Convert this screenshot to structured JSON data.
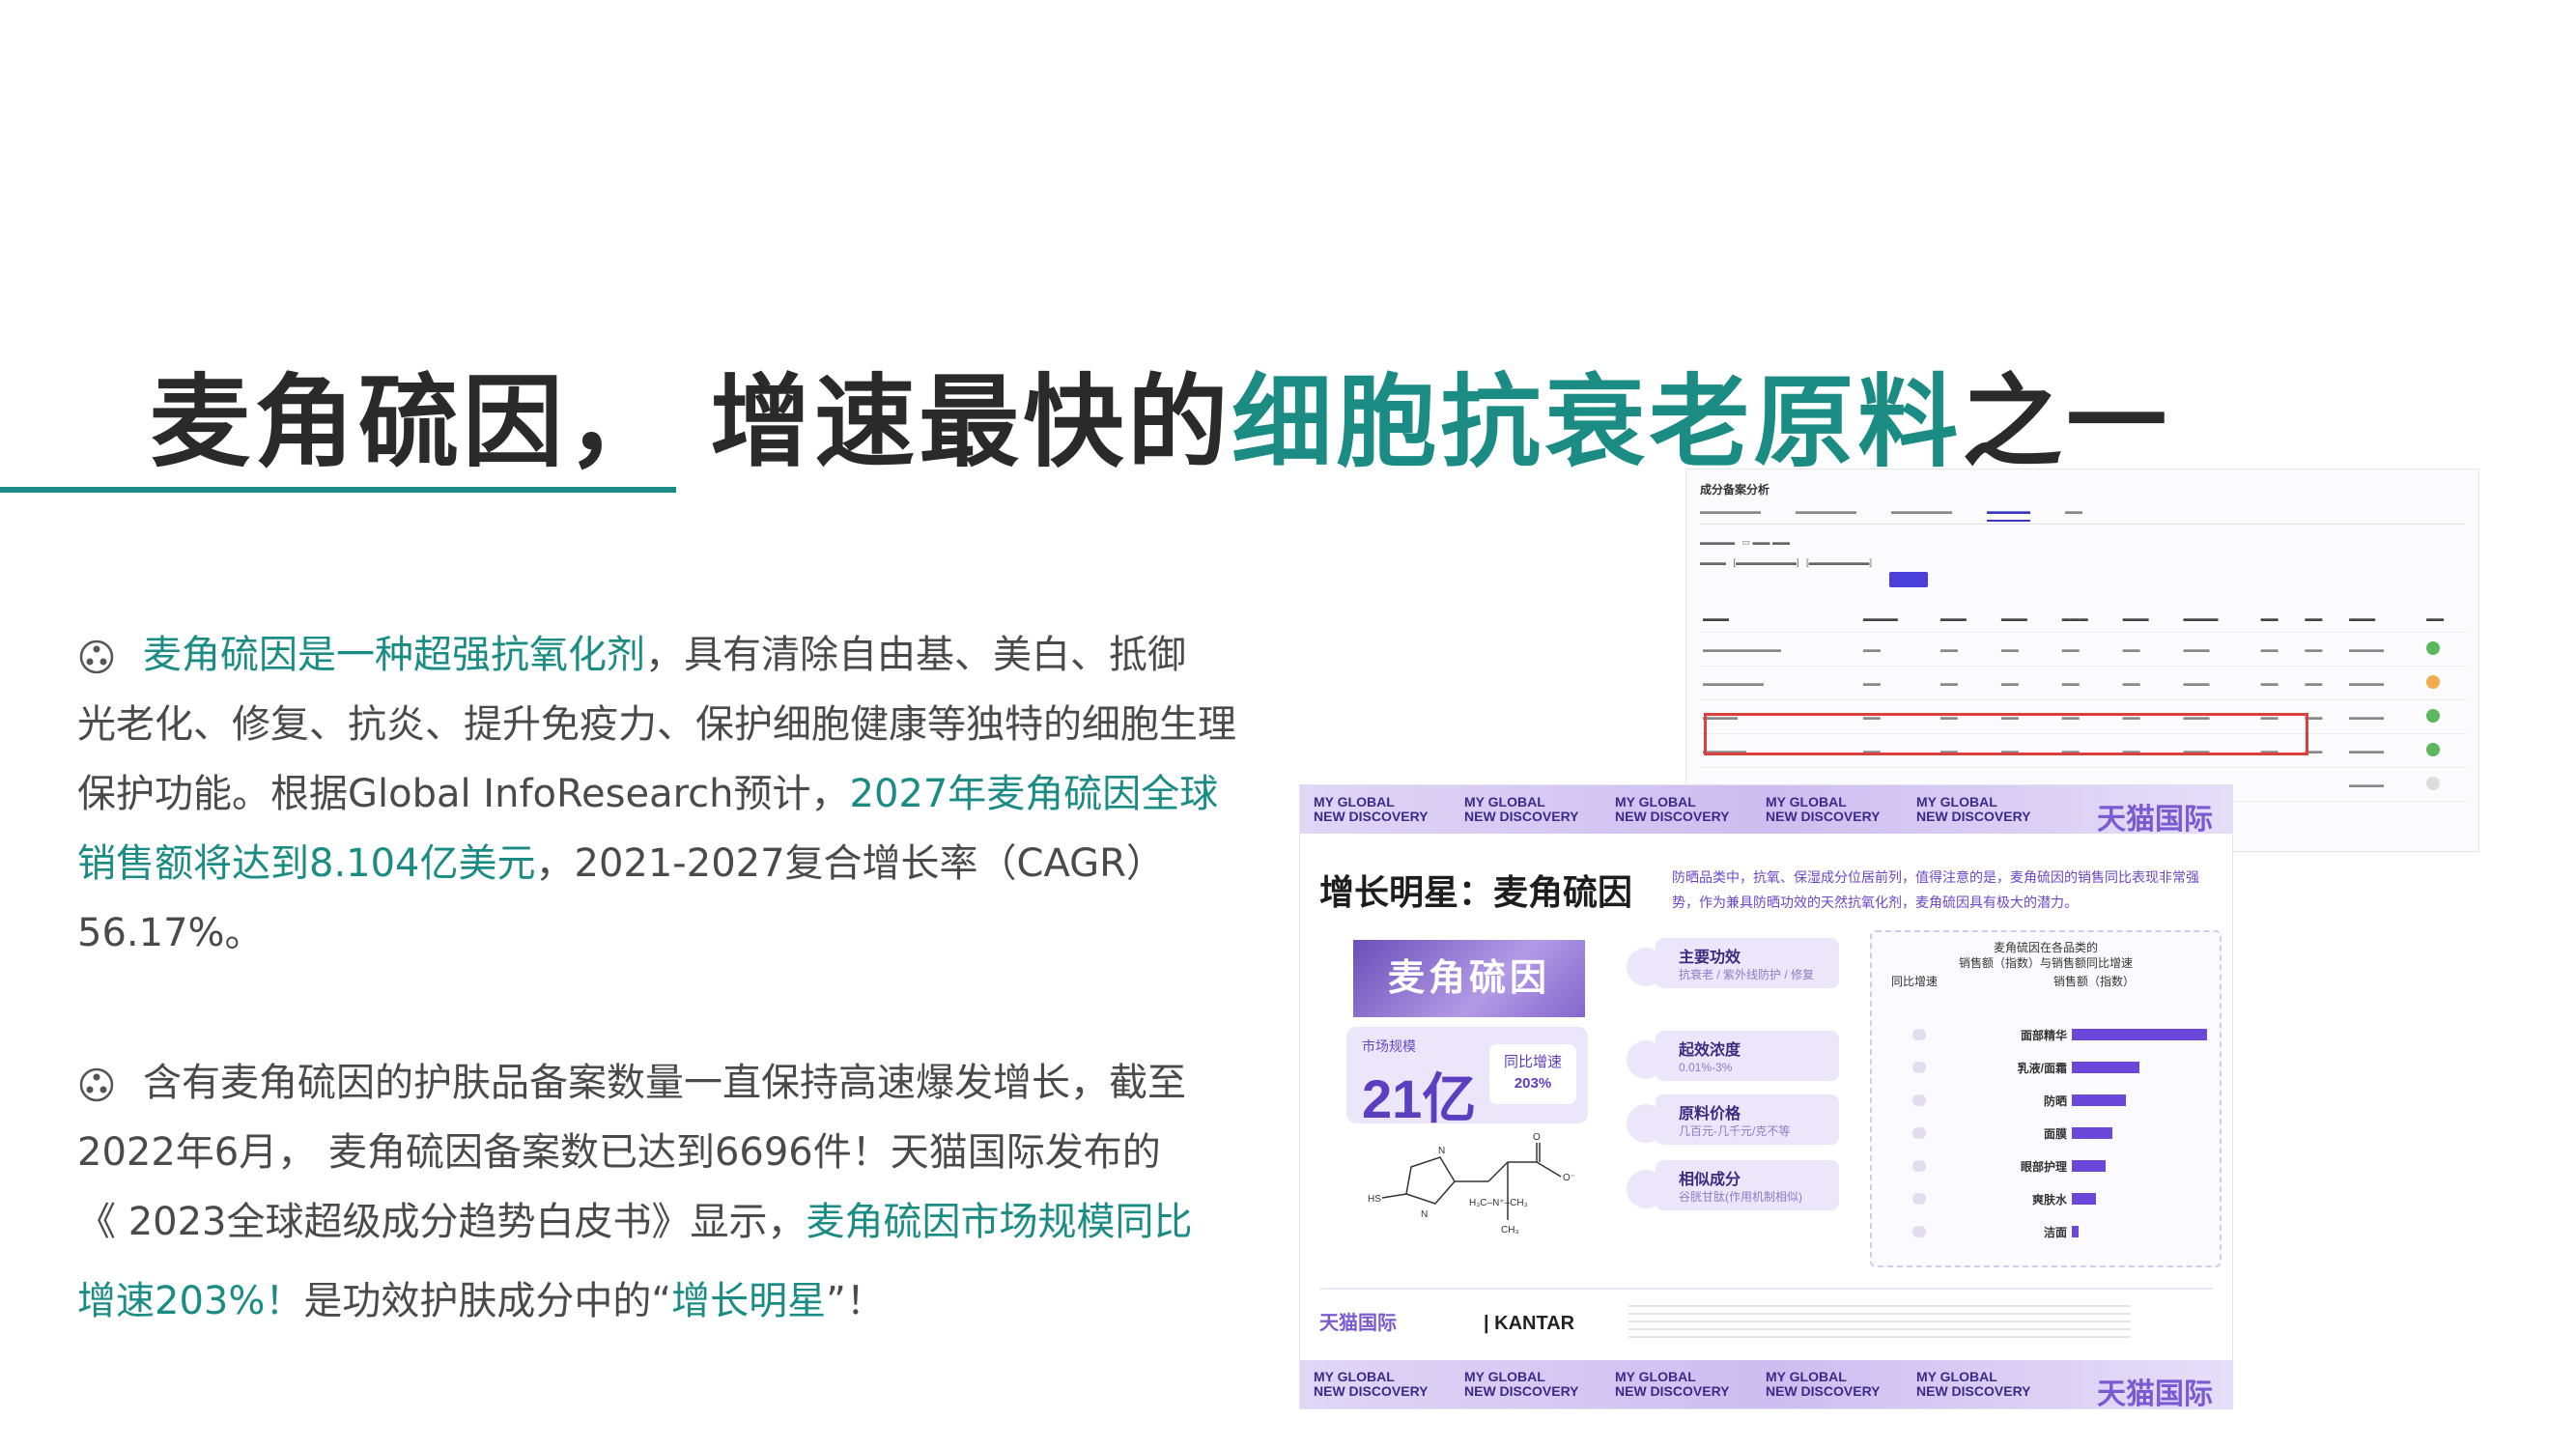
{
  "title": {
    "part1": "麦角硫因， 增速最快的",
    "highlight": "细胞抗衰老原料",
    "part2": "之一"
  },
  "paragraph1": {
    "highlight1": "麦角硫因是一种超强抗氧化剂",
    "text1": "，具有清除自由基、美白、抵御",
    "line2": "光老化、修复、抗炎、提升免疫力、保护细胞健康等独特的细胞生理",
    "line3_text": "保护功能。根据Global InfoResearch预计，",
    "line3_highlight": "2027年麦角硫因全球",
    "line4_highlight": "销售额将达到8.104亿美元",
    "line4_text": "，2021-2027复合增长率（CAGR）",
    "line5": "56.17%。"
  },
  "paragraph2": {
    "line1": "含有麦角硫因的护肤品备案数量一直保持高速爆发增长，截至",
    "line2": "2022年6月， 麦角硫因备案数已达到6696件！天猫国际发布的",
    "line3_text": "《 2023全球超级成分趋势白皮书》显示，",
    "line3_highlight": "麦角硫因市场规模同比",
    "line4_highlight": "增速203%！",
    "line4_text": "是功效护肤成分中的",
    "line4_quote_open": "“",
    "line4_highlight2": "增长明星",
    "line4_quote_close": "”！"
  },
  "screenshot_table": {
    "heading": "成分备案分析",
    "highlight_color": "#d94040"
  },
  "screenshot_card": {
    "band_tag_line1": "MY GLOBAL",
    "band_tag_line2": "NEW DISCOVERY",
    "band_logo": "天猫国际",
    "card_title": "增长明星：麦角硫因",
    "card_desc": "防晒品类中，抗氧、保湿成分位居前列，值得注意的是，麦角硫因的销售同比表现非常强势，作为兼具防晒功效的天然抗氧化剂，麦角硫因具有极大的潜力。",
    "ingredient_image_text": "麦角硫因",
    "market_label": "市场规模",
    "market_value": "21亿",
    "market_growth_label": "同比增速",
    "market_growth_value": "203%",
    "features": [
      {
        "title": "主要功效",
        "value": "抗衰老 / 紫外线防护 / 修复"
      },
      {
        "title": "起效浓度",
        "value": "0.01%-3%"
      },
      {
        "title": "原料价格",
        "value": "几百元-几千元/克不等"
      },
      {
        "title": "相似成分",
        "value": "谷胱甘肽(作用机制相似)"
      }
    ],
    "panel_heading_line1": "麦角硫因在各品类的",
    "panel_heading_line2": "销售额（指数）与销售额同比增速",
    "panel_col_left": "同比增速",
    "panel_col_right": "销售额（指数）",
    "panel_categories": [
      {
        "name": "面部精华",
        "index": 1.0
      },
      {
        "name": "乳液/面霜",
        "index": 0.5
      },
      {
        "name": "防晒",
        "index": 0.4
      },
      {
        "name": "面膜",
        "index": 0.3
      },
      {
        "name": "眼部护理",
        "index": 0.25
      },
      {
        "name": "爽肤水",
        "index": 0.18
      },
      {
        "name": "洁面",
        "index": 0.05
      }
    ],
    "footer_brand": "天猫国际",
    "footer_kantar": "| KANTAR"
  }
}
